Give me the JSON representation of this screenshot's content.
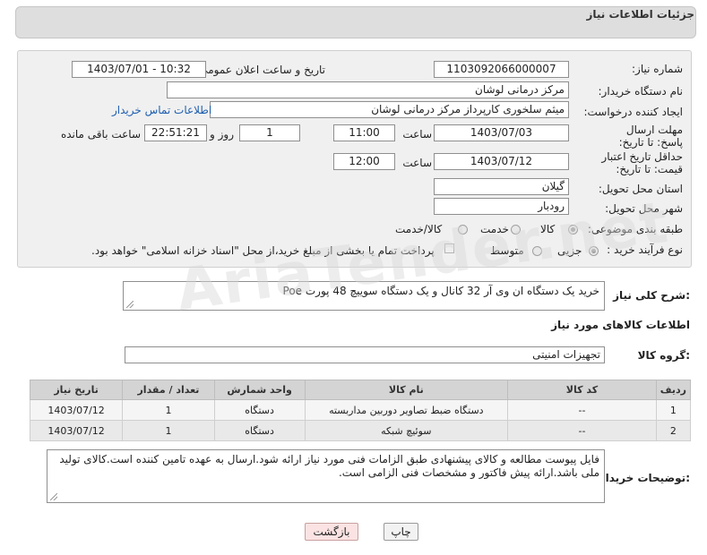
{
  "header": {
    "title": "جزئیات اطلاعات نیاز"
  },
  "form": {
    "need_number_label": "شماره نیاز:",
    "need_number": "1103092066000007",
    "announce_label": "تاریخ و ساعت اعلان عمومی:",
    "announce_value": "1403/07/01 - 10:32",
    "buyer_org_label": "نام دستگاه خریدار:",
    "buyer_org": "مرکز درمانی لوشان",
    "creator_label": "ایجاد کننده درخواست:",
    "creator": "میثم سلخوری کارپرداز مرکز درمانی لوشان",
    "contact_link": "اطلاعات تماس خریدار",
    "deadline_label": "مهلت ارسال پاسخ: تا تاریخ:",
    "deadline_date": "1403/07/03",
    "time_label": "ساعت",
    "deadline_time": "11:00",
    "days_value": "1",
    "days_label": "روز و",
    "remaining_time": "22:51:21",
    "remaining_label": "ساعت باقی مانده",
    "validity_label": "حداقل تاریخ اعتبار قیمت: تا تاریخ:",
    "validity_date": "1403/07/12",
    "validity_time": "12:00",
    "province_label": "استان محل تحویل:",
    "province": "گیلان",
    "city_label": "شهر محل تحویل:",
    "city": "رودبار",
    "category_label": "طبقه بندی موضوعی:",
    "category_options": [
      "کالا",
      "خدمت",
      "کالا/خدمت"
    ],
    "process_label": "نوع فرآیند خرید :",
    "process_options": [
      "جزیی",
      "متوسط"
    ],
    "payment_note": "پرداخت تمام یا بخشی از مبلغ خرید،از محل \"اسناد خزانه اسلامی\" خواهد بود."
  },
  "summary": {
    "label": "شرح کلی نیاز:",
    "text": "خرید یک دستگاه ان وی آر 32 کانال و یک دستگاه سوییچ 48 پورت Poe"
  },
  "goods": {
    "section_title": "اطلاعات کالاهای مورد نیاز",
    "group_label": "گروه کالا:",
    "group_value": "تجهیزات امنیتی",
    "columns": [
      "ردیف",
      "کد کالا",
      "نام کالا",
      "واحد شمارش",
      "تعداد / مقدار",
      "تاریخ نیاز"
    ],
    "rows": [
      {
        "index": "1",
        "code": "--",
        "name": "دستگاه ضبط تصاویر دوربین مداربسته",
        "unit": "دستگاه",
        "qty": "1",
        "date": "1403/07/12"
      },
      {
        "index": "2",
        "code": "--",
        "name": "سوئیچ شبکه",
        "unit": "دستگاه",
        "qty": "1",
        "date": "1403/07/12"
      }
    ]
  },
  "buyer_notes": {
    "label": "توضیحات خریدار:",
    "text": "فایل پیوست مطالعه و کالای پیشنهادی طبق الزامات فنی مورد نیاز ارائه شود.ارسال به عهده تامین کننده است.کالای تولید ملی باشد.ارائه پیش فاکتور و مشخصات فنی الزامی است."
  },
  "actions": {
    "print_label": "چاپ",
    "back_label": "بازگشت"
  },
  "watermark": "AriaTender.net",
  "colors": {
    "link": "#1e5eb0",
    "header_bg": "#dedede",
    "form_bg": "#f0f0f0",
    "back_button_bg": "#fbe3e3"
  }
}
